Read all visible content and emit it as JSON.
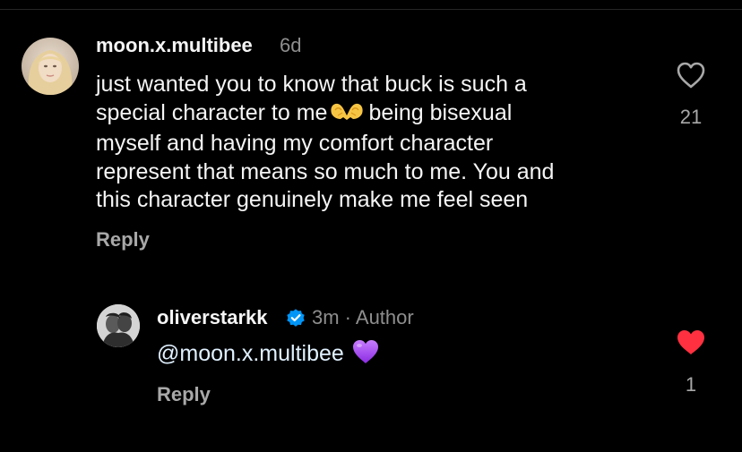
{
  "comment": {
    "username": "moon.x.multibee",
    "time": "6d",
    "text_line1": "just wanted you to know that buck is such a",
    "text_line2_a": "special character to me",
    "text_line2_b": "being bisexual",
    "text_line3": "myself and having my comfort character",
    "text_line4": "represent that means so much to me. You and",
    "text_line5": "this character genuinely make me feel seen",
    "reply_label": "Reply",
    "like_count": "21",
    "liked": false
  },
  "reply": {
    "username": "oliverstarkk",
    "verified": true,
    "meta": "3m · Author",
    "mention": "@moon.x.multibee",
    "reply_label": "Reply",
    "like_count": "1",
    "liked": true
  },
  "colors": {
    "background": "#000000",
    "liked_heart": "#ff3040",
    "verified_badge": "#0095f6",
    "mention_text": "#e0f1ff",
    "secondary_text": "#8e8e8e"
  },
  "icons": {
    "emoji_1": "heart-hands-emoji",
    "emoji_2": "purple-heart-emoji",
    "like": "heart-outline-icon",
    "liked": "heart-filled-icon",
    "verified": "verified-badge-icon"
  }
}
